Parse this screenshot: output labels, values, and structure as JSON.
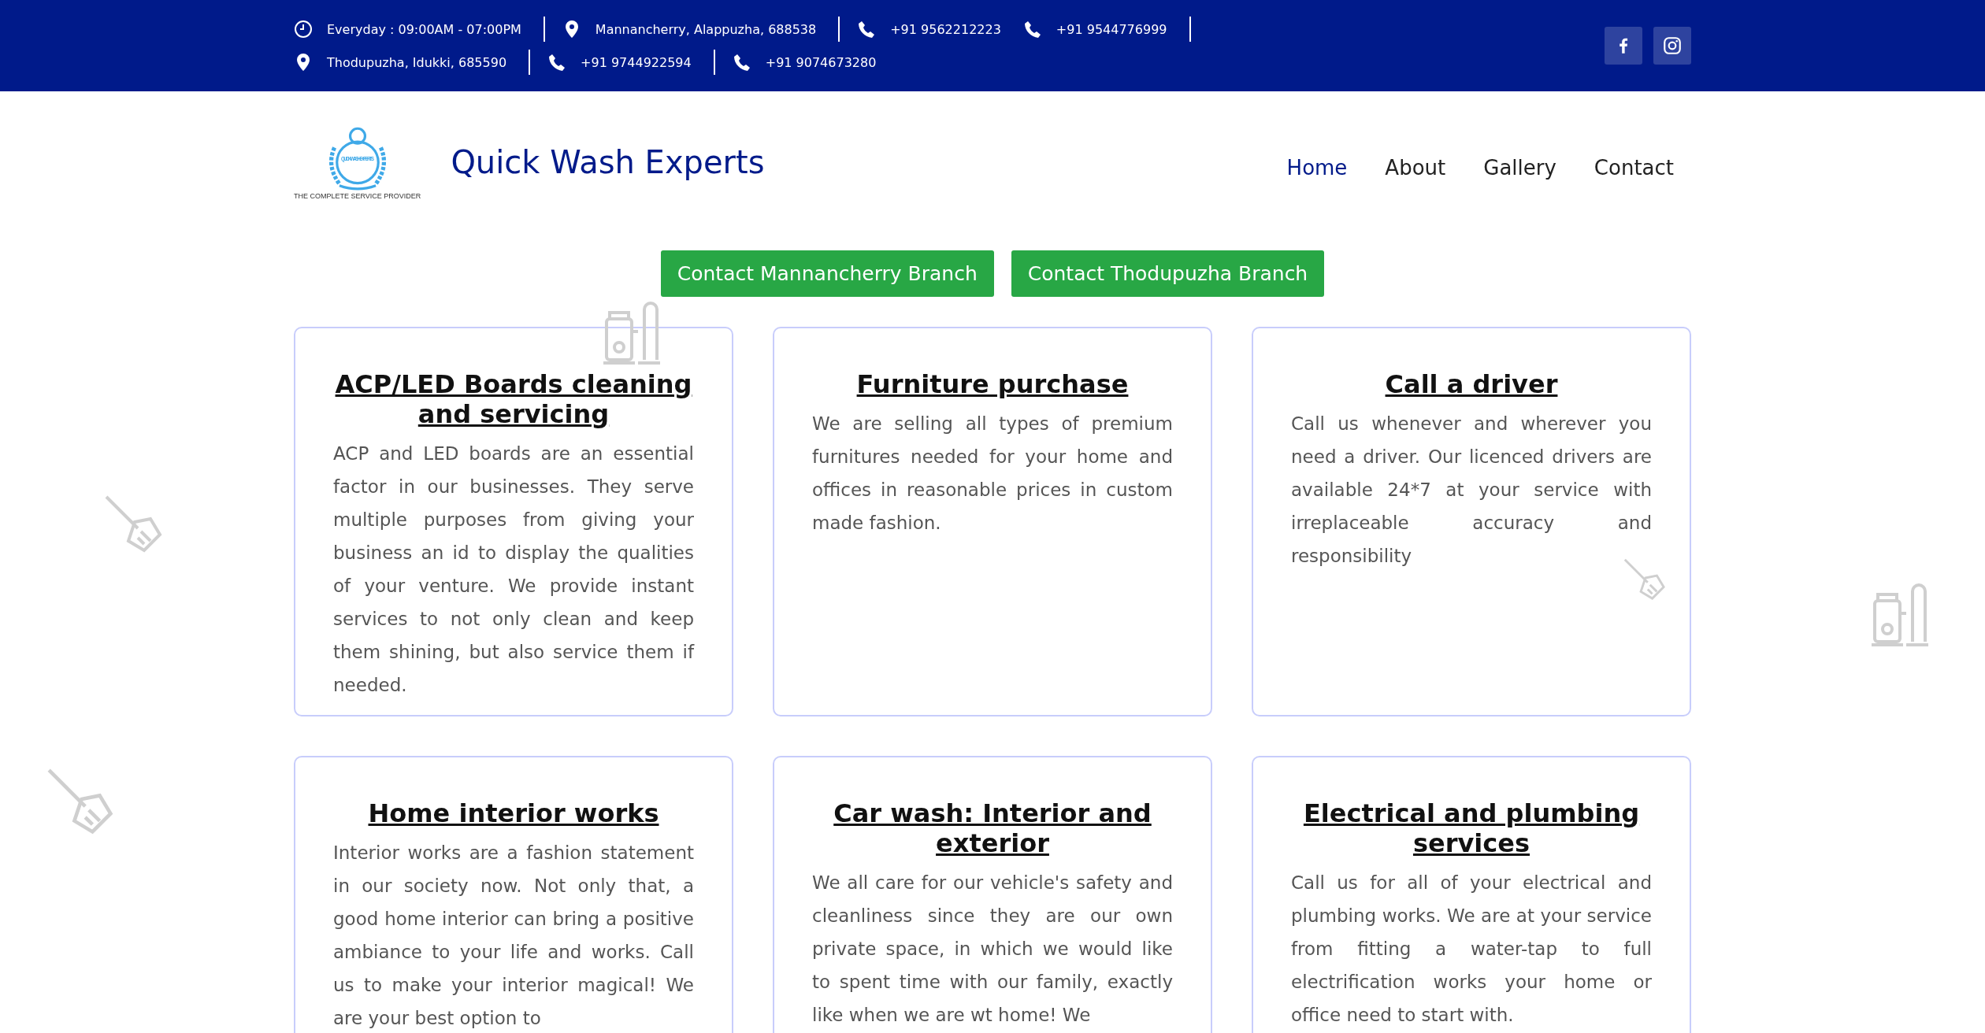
{
  "top_bar": {
    "rows": [
      [
        {
          "kind": "clock",
          "text": "Everyday : 09:00AM - 07:00PM",
          "divider_after": true
        },
        {
          "kind": "pin",
          "text": "Mannancherry, Alappuzha, 688538",
          "divider_after": true
        },
        {
          "kind": "phone",
          "text": "+91 9562212223",
          "divider_after": false
        },
        {
          "kind": "phone",
          "text": "+91 9544776999",
          "divider_after": true
        }
      ],
      [
        {
          "kind": "pin",
          "text": "Thodupuzha, Idukki, 685590",
          "divider_after": true
        },
        {
          "kind": "phone",
          "text": "+91 9744922594",
          "divider_after": true
        },
        {
          "kind": "phone",
          "text": "+91 9074673280",
          "divider_after": false
        }
      ]
    ],
    "social": [
      {
        "kind": "facebook"
      },
      {
        "kind": "instagram"
      }
    ]
  },
  "header": {
    "logo": {
      "badge_text": "QUICK WASH EXPERTS",
      "tagline": "THE COMPLETE SERVICE PROVIDER"
    },
    "site_title": "Quick Wash Experts",
    "nav": [
      {
        "label": "Home",
        "selected": true
      },
      {
        "label": "About",
        "selected": false
      },
      {
        "label": "Gallery",
        "selected": false
      },
      {
        "label": "Contact",
        "selected": false
      }
    ]
  },
  "branch_buttons": [
    "Contact Mannancherry Branch",
    "Contact Thodupuzha Branch"
  ],
  "services": [
    {
      "title": "ACP/LED Boards cleaning and servicing",
      "text": "ACP and LED boards are an essential factor in our businesses. They serve multiple purposes from giving your business an id to display the qualities of your venture. We provide instant services to not only clean and keep them shining, but also service them if needed."
    },
    {
      "title": "Furniture purchase",
      "text": "We are selling all types of premium furnitures needed for your home and offices in reasonable prices in custom made fashion."
    },
    {
      "title": "Call a driver",
      "text": "Call us whenever and wherever you need a driver. Our licenced drivers are available 24*7 at your service with irreplaceable accuracy and responsibility"
    },
    {
      "title": "Home interior works",
      "text": "Interior works are a fashion statement in our society now. Not only that, a good home interior can bring a positive ambiance to your life and works. Call us to make your interior magical! We are your best option to"
    },
    {
      "title": "Car wash: Interior and exterior",
      "text": "We all care for our vehicle's safety and cleanliness since they are our own private space, in which we would like to spent time with our family, exactly like when we are wt home! We"
    },
    {
      "title": "Electrical and plumbing services",
      "text": "Call us for all of your electrical and plumbing works. We are at your service from fitting a water-tap to full electrification works your home or office need to start with."
    }
  ]
}
